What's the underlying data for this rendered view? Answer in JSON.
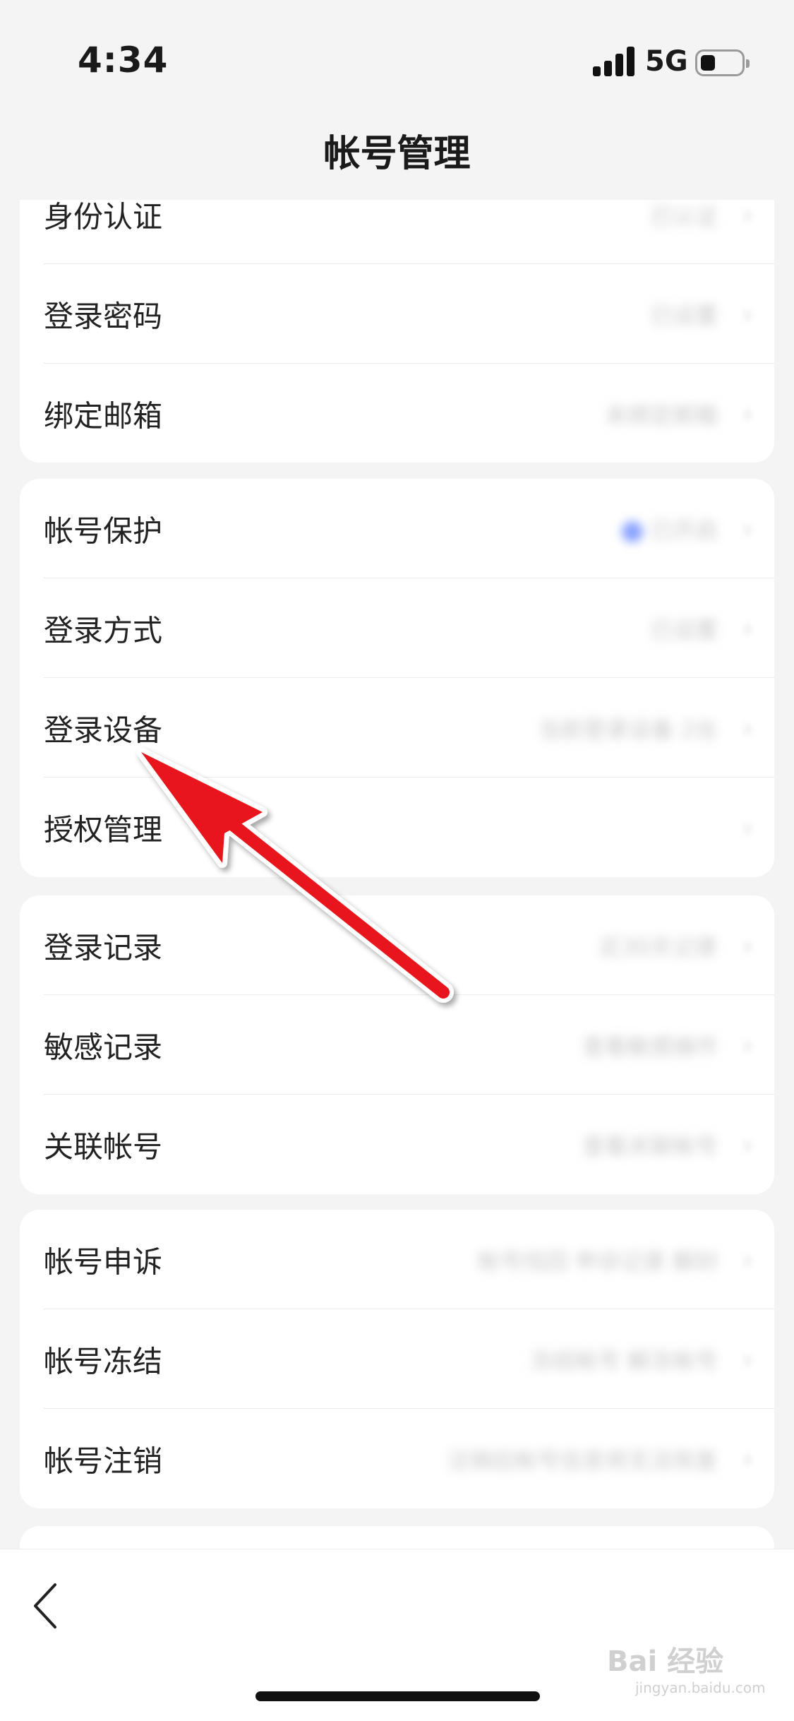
{
  "status_bar": {
    "time": "4:34",
    "network": "5G"
  },
  "nav": {
    "title": "帐号管理"
  },
  "groups": [
    {
      "rows": [
        {
          "label": "身份认证",
          "value": "已认证"
        },
        {
          "label": "登录密码",
          "value": "已设置"
        },
        {
          "label": "绑定邮箱",
          "value": "未绑定邮箱"
        }
      ]
    },
    {
      "rows": [
        {
          "label": "帐号保护",
          "value": "已开启"
        },
        {
          "label": "登录方式",
          "value": "已设置"
        },
        {
          "label": "登录设备",
          "value": "当前登录设备 2台"
        },
        {
          "label": "授权管理",
          "value": ""
        }
      ]
    },
    {
      "rows": [
        {
          "label": "登录记录",
          "value": "近30天记录"
        },
        {
          "label": "敏感记录",
          "value": "查看敏感操作"
        },
        {
          "label": "关联帐号",
          "value": "查看关联帐号"
        }
      ]
    },
    {
      "rows": [
        {
          "label": "帐号申诉",
          "value": "帐号找回 申诉记录 解封"
        },
        {
          "label": "帐号冻结",
          "value": "冻结帐号 解冻帐号"
        },
        {
          "label": "帐号注销",
          "value": "注销后帐号信息将无法恢复"
        }
      ]
    }
  ],
  "watermark": {
    "brand": "Bai 经验",
    "url": "jingyan.baidu.com"
  },
  "colors": {
    "annotation_arrow": "#e8151b",
    "accent_blue": "#8aa2ff"
  },
  "icons": {
    "back": "chevron-left-icon",
    "chevron": "chevron-right-icon"
  }
}
